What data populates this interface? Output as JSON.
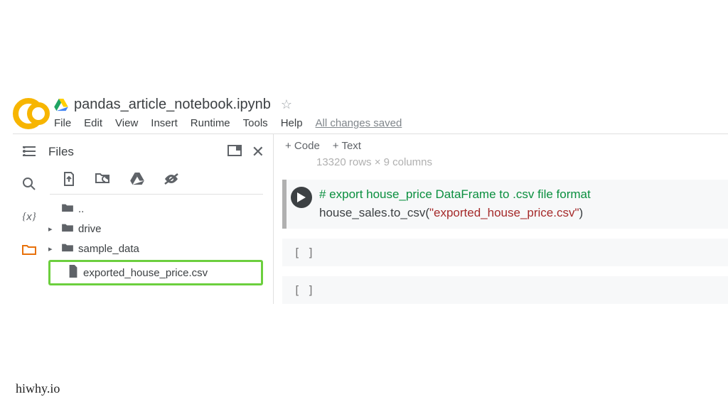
{
  "header": {
    "filename": "pandas_article_notebook.ipynb",
    "menus": [
      "File",
      "Edit",
      "View",
      "Insert",
      "Runtime",
      "Tools",
      "Help"
    ],
    "saved": "All changes saved"
  },
  "sidebar": {
    "title": "Files",
    "tree": {
      "up": "..",
      "drive": "drive",
      "sample": "sample_data",
      "exported": "exported_house_price.csv"
    }
  },
  "main": {
    "add_code": "+  Code",
    "add_text": "+  Text",
    "meta": "13320 rows × 9 columns",
    "code_comment": "# export house_price DataFrame to .csv file format",
    "code_line_pre": "house_sales.to_csv(",
    "code_str": "\"exported_house_price.csv\"",
    "code_line_post": ")",
    "empty": "[ ]"
  },
  "watermark": "hiwhy.io"
}
